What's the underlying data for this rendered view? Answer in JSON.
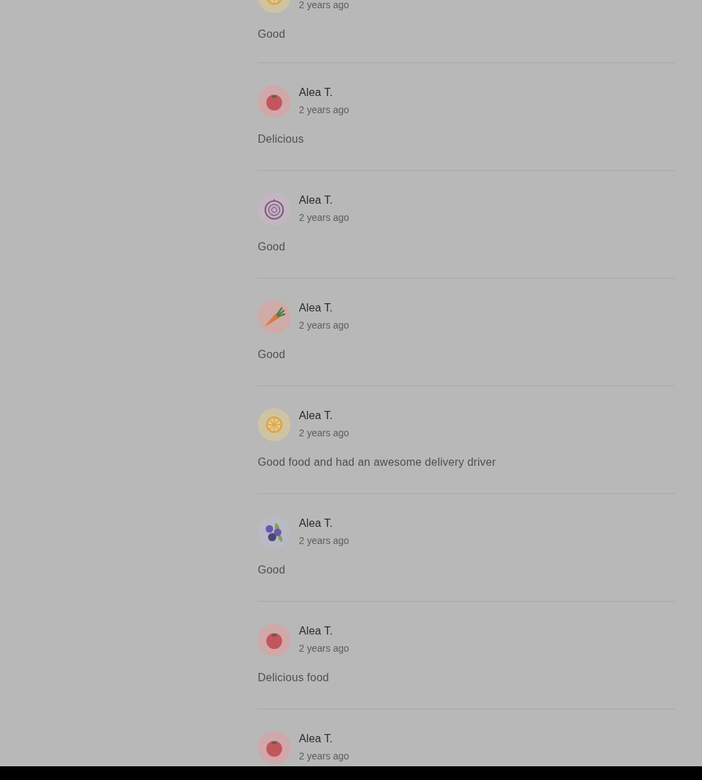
{
  "reviews": [
    {
      "avatar": {
        "kind": "citrus"
      },
      "time": "2 years ago",
      "text": "Good"
    },
    {
      "author": "Alea T.",
      "avatar": {
        "kind": "tomato"
      },
      "time": "2 years ago",
      "text": "Delicious"
    },
    {
      "author": "Alea T.",
      "avatar": {
        "kind": "onion"
      },
      "time": "2 years ago",
      "text": "Good"
    },
    {
      "author": "Alea T.",
      "avatar": {
        "kind": "carrot"
      },
      "time": "2 years ago",
      "text": "Good"
    },
    {
      "author": "Alea T.",
      "avatar": {
        "kind": "citrus"
      },
      "time": "2 years ago",
      "text": "Good food and had an awesome delivery driver"
    },
    {
      "author": "Alea T.",
      "avatar": {
        "kind": "blueberry"
      },
      "time": "2 years ago",
      "text": "Good"
    },
    {
      "author": "Alea T.",
      "avatar": {
        "kind": "tomato"
      },
      "time": "2 years ago",
      "text": "Delicious food"
    },
    {
      "author": "Alea T.",
      "avatar": {
        "kind": "tomato"
      },
      "time": "2 years ago"
    }
  ]
}
